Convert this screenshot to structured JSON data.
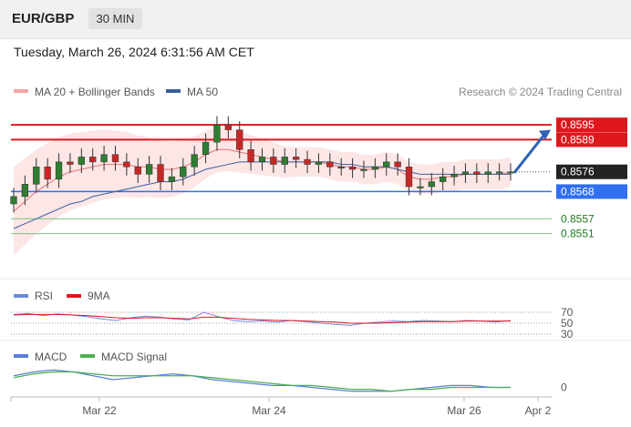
{
  "header": {
    "symbol": "EUR/GBP",
    "timeframe": "30 MIN",
    "datetime": "Tuesday, March 26, 2024 6:31:56 AM CET"
  },
  "colors": {
    "bull_candle": "#2e7d32",
    "bear_candle": "#c62828",
    "bollinger": "#f4a5a5",
    "ma20": "#e57373",
    "ma50": "#3a5f9e",
    "resistance": "#e0161d",
    "support": "#2f6ff0",
    "current": "#222222",
    "target_green": "#7cc07c",
    "rsi": "#6a8bd6",
    "rsi_ma": "#e0161d",
    "macd": "#5b7fd6",
    "macd_signal": "#4caf50",
    "arrow": "#2f62b5"
  },
  "chart_data": [
    {
      "type": "candlestick",
      "panel": "price",
      "legend": [
        {
          "label": "MA 20 + Bollinger Bands",
          "color": "#f4a5a5"
        },
        {
          "label": "MA 50",
          "color": "#3a5f9e"
        }
      ],
      "credit": "Research © 2024 Trading Central",
      "ylim": [
        0.8535,
        0.8605
      ],
      "levels": [
        {
          "label": "0.8595",
          "value": 0.8595,
          "kind": "resistance"
        },
        {
          "label": "0.8589",
          "value": 0.8589,
          "kind": "resistance"
        },
        {
          "label": "0.8576",
          "value": 0.8576,
          "kind": "current"
        },
        {
          "label": "0.8568",
          "value": 0.8568,
          "kind": "support"
        },
        {
          "label": "0.8557",
          "value": 0.8557,
          "kind": "target"
        },
        {
          "label": "0.8551",
          "value": 0.8551,
          "kind": "target"
        }
      ],
      "x_ticks": [
        "Mar 22",
        "Mar 24",
        "Mar 26",
        "Apr 2"
      ],
      "closes": [
        0.8566,
        0.8571,
        0.8578,
        0.8573,
        0.858,
        0.8579,
        0.8582,
        0.858,
        0.8583,
        0.858,
        0.8578,
        0.8575,
        0.8579,
        0.8572,
        0.8574,
        0.8578,
        0.8583,
        0.8588,
        0.8595,
        0.8593,
        0.8585,
        0.858,
        0.8582,
        0.8579,
        0.8582,
        0.8581,
        0.8579,
        0.858,
        0.8578,
        0.8578,
        0.8577,
        0.8577,
        0.8578,
        0.858,
        0.8578,
        0.857,
        0.857,
        0.8572,
        0.8574,
        0.8575,
        0.8576,
        0.8575,
        0.8576,
        0.8576,
        0.8576
      ],
      "ma20": [
        0.856,
        0.8564,
        0.8568,
        0.8571,
        0.8574,
        0.8576,
        0.8577,
        0.8578,
        0.8579,
        0.8579,
        0.8579,
        0.8578,
        0.8578,
        0.8577,
        0.8577,
        0.8578,
        0.858,
        0.8583,
        0.8585,
        0.8585,
        0.8584,
        0.8583,
        0.8582,
        0.8581,
        0.858,
        0.858,
        0.858,
        0.858,
        0.8579,
        0.8578,
        0.8578,
        0.8577,
        0.8577,
        0.8578,
        0.8577,
        0.8574,
        0.8573,
        0.8573,
        0.8574,
        0.8574,
        0.8575,
        0.8575,
        0.8575,
        0.8575,
        0.8576
      ],
      "ma50": [
        0.8553,
        0.8555,
        0.8557,
        0.8559,
        0.8561,
        0.8563,
        0.8564,
        0.8566,
        0.8567,
        0.8568,
        0.8569,
        0.857,
        0.8571,
        0.8572,
        0.8572,
        0.8573,
        0.8575,
        0.8577,
        0.8578,
        0.8579,
        0.858,
        0.858,
        0.858,
        0.858,
        0.858,
        0.858,
        0.858,
        0.858,
        0.858,
        0.8579,
        0.8579,
        0.8578,
        0.8578,
        0.8578,
        0.8577,
        0.8576,
        0.8575,
        0.8575,
        0.8575,
        0.8575,
        0.8575,
        0.8575,
        0.8575,
        0.8575,
        0.8575
      ]
    },
    {
      "type": "line",
      "panel": "rsi",
      "legend": [
        {
          "label": "RSI",
          "color": "#6a8bd6"
        },
        {
          "label": "9MA",
          "color": "#e0161d"
        }
      ],
      "ylim": [
        25,
        75
      ],
      "y_ticks": [
        {
          "label": "70",
          "value": 70
        },
        {
          "label": "50",
          "value": 50
        },
        {
          "label": "30",
          "value": 30
        }
      ],
      "series": [
        {
          "name": "RSI",
          "values": [
            66,
            68,
            64,
            67,
            65,
            62,
            58,
            55,
            60,
            63,
            61,
            58,
            56,
            70,
            62,
            55,
            53,
            54,
            52,
            55,
            53,
            50,
            48,
            46,
            50,
            52,
            54,
            53,
            55,
            54,
            53,
            55,
            54,
            52,
            55
          ]
        },
        {
          "name": "9MA",
          "values": [
            65,
            66,
            66,
            66,
            65,
            64,
            62,
            60,
            59,
            60,
            60,
            59,
            58,
            61,
            61,
            59,
            57,
            56,
            55,
            55,
            54,
            53,
            52,
            50,
            50,
            50,
            51,
            52,
            53,
            53,
            53,
            54,
            54,
            54,
            54
          ]
        }
      ]
    },
    {
      "type": "line",
      "panel": "macd",
      "legend": [
        {
          "label": "MACD",
          "color": "#5b7fd6"
        },
        {
          "label": "MACD Signal",
          "color": "#4caf50"
        }
      ],
      "ylim": [
        -0.0004,
        0.0012
      ],
      "y_ticks": [
        {
          "label": "0",
          "value": 0
        }
      ],
      "series": [
        {
          "name": "MACD",
          "values": [
            0.0006,
            0.0008,
            0.0009,
            0.0008,
            0.0006,
            0.0004,
            0.0005,
            0.0006,
            0.0007,
            0.0006,
            0.0004,
            0.0003,
            0.0002,
            0.0001,
            0.0001,
            0.0,
            -0.0001,
            -0.0002,
            -0.0002,
            -0.0002,
            -0.0001,
            0.0,
            0.0001,
            0.0001,
            0.0,
            0.0
          ]
        },
        {
          "name": "MACD Signal",
          "values": [
            0.0005,
            0.0007,
            0.0008,
            0.0008,
            0.0007,
            0.0006,
            0.0006,
            0.0006,
            0.0006,
            0.0006,
            0.0005,
            0.0004,
            0.0003,
            0.0002,
            0.0001,
            0.0001,
            0.0,
            -0.0001,
            -0.0001,
            -0.0002,
            -0.0001,
            -0.0001,
            0.0,
            0.0,
            0.0,
            0.0
          ]
        }
      ]
    }
  ]
}
